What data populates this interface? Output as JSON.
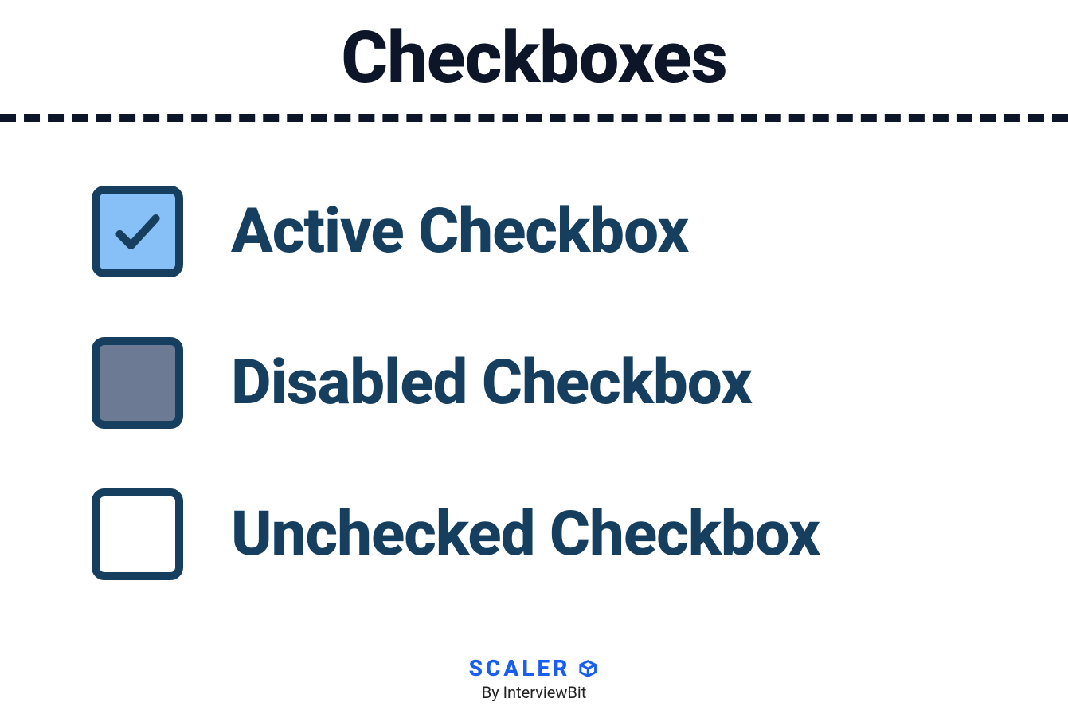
{
  "title": "Checkboxes",
  "items": [
    {
      "label": "Active Checkbox",
      "state": "active"
    },
    {
      "label": "Disabled Checkbox",
      "state": "disabled"
    },
    {
      "label": "Unchecked Checkbox",
      "state": "unchecked"
    }
  ],
  "footer": {
    "brand": "SCALER",
    "subtitle": "By InterviewBit"
  },
  "colors": {
    "title": "#0d1629",
    "primary": "#163f5f",
    "activeFill": "#87c0f6",
    "disabledFill": "#6d7a94",
    "brand": "#1a5ef0"
  }
}
